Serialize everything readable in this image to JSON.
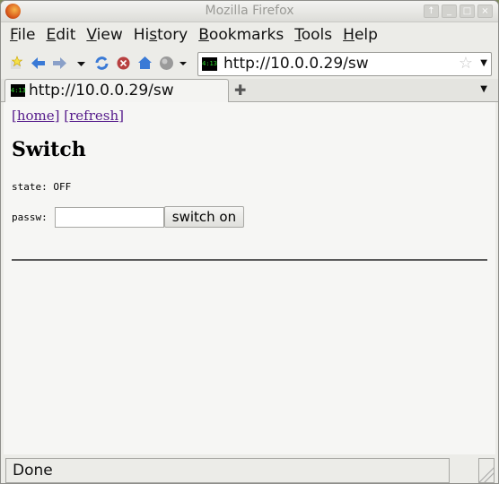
{
  "window": {
    "title": "Mozilla Firefox",
    "buttons": [
      "up",
      "minimize",
      "maximize",
      "close"
    ]
  },
  "menubar": {
    "items": [
      {
        "label": "File",
        "mnemonic": "F",
        "rest": "ile"
      },
      {
        "label": "Edit",
        "mnemonic": "E",
        "rest": "dit"
      },
      {
        "label": "View",
        "mnemonic": "V",
        "rest": "iew"
      },
      {
        "label": "History",
        "pre": "Hi",
        "mnemonic": "s",
        "rest": "tory"
      },
      {
        "label": "Bookmarks",
        "mnemonic": "B",
        "rest": "ookmarks"
      },
      {
        "label": "Tools",
        "mnemonic": "T",
        "rest": "ools"
      },
      {
        "label": "Help",
        "mnemonic": "H",
        "rest": "elp"
      }
    ]
  },
  "navbar": {
    "url": "http://10.0.0.29/sw",
    "site_icon_text": "4:13"
  },
  "tabs": [
    {
      "label": "http://10.0.0.29/sw",
      "icon_text": "4:13"
    }
  ],
  "page": {
    "links": [
      "[home]",
      "[refresh]"
    ],
    "heading": "Switch",
    "state_label": "state:",
    "state_value": "OFF",
    "passw_label": "passw:",
    "passw_value": "",
    "button_label": "switch on"
  },
  "status": {
    "text": "Done"
  }
}
